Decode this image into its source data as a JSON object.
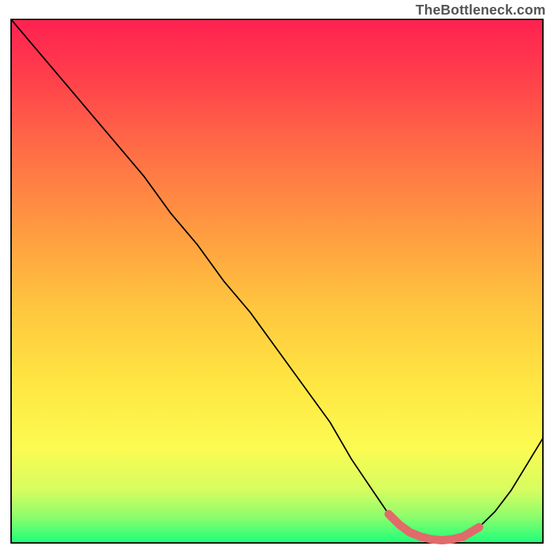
{
  "watermark": "TheBottleneck.com",
  "chart_data": {
    "type": "line",
    "title": "",
    "xlabel": "",
    "ylabel": "",
    "xlim": [
      0,
      100
    ],
    "ylim": [
      0,
      100
    ],
    "series": [
      {
        "name": "curve",
        "color": "#000000",
        "x": [
          0,
          5,
          10,
          15,
          20,
          25,
          30,
          35,
          40,
          45,
          50,
          55,
          60,
          64,
          68,
          71,
          73,
          75,
          77,
          79,
          81,
          83,
          85,
          88,
          91,
          94,
          97,
          100
        ],
        "y": [
          100,
          94,
          88,
          82,
          76,
          70,
          63,
          57,
          50,
          44,
          37,
          30,
          23,
          16,
          10,
          5.5,
          3.5,
          2.0,
          1.2,
          0.7,
          0.5,
          0.7,
          1.2,
          3.0,
          6.0,
          10.0,
          15.0,
          20.0
        ]
      },
      {
        "name": "highlight",
        "color": "#e16a6a",
        "x": [
          71,
          73,
          75,
          77,
          79,
          81,
          83,
          85,
          88
        ],
        "y": [
          5.5,
          3.5,
          2.0,
          1.2,
          0.7,
          0.5,
          0.7,
          1.2,
          3.0
        ]
      }
    ],
    "background_gradient": {
      "top": "#ff2150",
      "mid": "#ffe742",
      "bottom": "#1cff7a"
    }
  }
}
